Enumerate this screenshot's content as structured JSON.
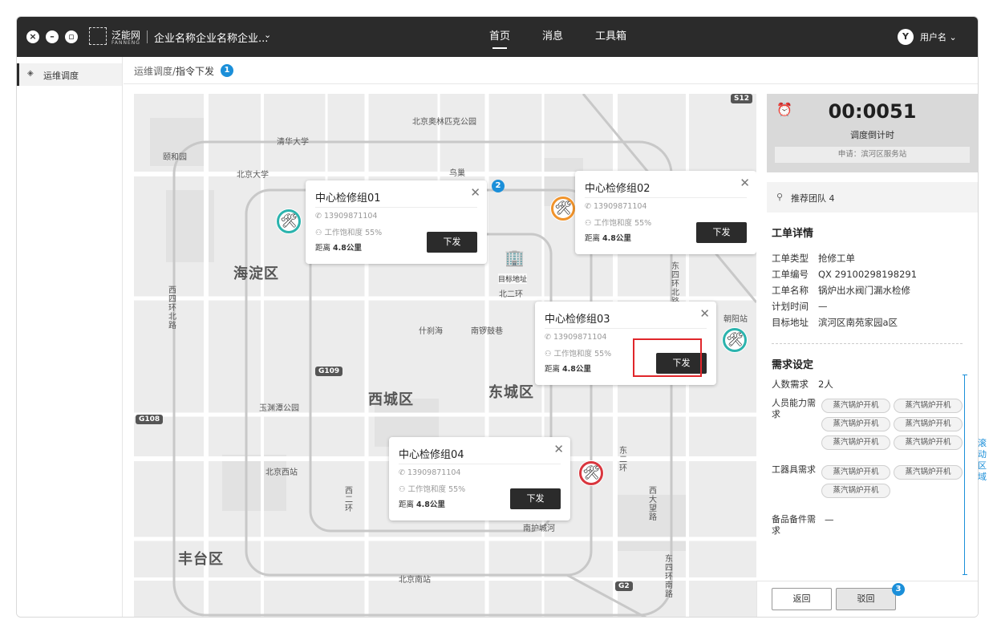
{
  "window": {
    "company": "企业名称企业名称企业...",
    "brand": "泛能网",
    "brand_en": "FANNENG"
  },
  "nav": [
    "首页",
    "消息",
    "工具箱"
  ],
  "user": {
    "initial": "Y",
    "name": "用户名"
  },
  "sidebar": {
    "item": "运维调度"
  },
  "breadcrumb": {
    "parent": "运维调度/",
    "current": "指令下发"
  },
  "markers": [
    "1",
    "2",
    "3"
  ],
  "map": {
    "districts": [
      "海淀区",
      "西城区",
      "东城区",
      "丰台区"
    ],
    "pois": [
      "清华大学",
      "北京大学",
      "北京奥林匹克公园",
      "颐和园",
      "什刹海",
      "南锣鼓巷",
      "玉渊潭公园",
      "北京西站",
      "北京南站",
      "朝阳站",
      "南护城河",
      "北二环",
      "鸟巢",
      "西四环北路",
      "东四环北路",
      "东二环",
      "西二环",
      "西大望路",
      "东四环南路"
    ],
    "road_badges": [
      "G109",
      "G108",
      "G2",
      "S12"
    ],
    "target_label": "目标地址",
    "pins": [
      {
        "icon": "🛠",
        "status": "teal"
      },
      {
        "icon": "🛠",
        "status": "orange"
      },
      {
        "icon": "🛠",
        "status": "teal"
      },
      {
        "icon": "🛠",
        "status": "red"
      }
    ]
  },
  "cards": [
    {
      "title": "中心检修组01",
      "phone": "13909871104",
      "load": "工作饱和度 55%",
      "dist_label": "距离",
      "dist": "4.8公里",
      "btn": "下发"
    },
    {
      "title": "中心检修组02",
      "phone": "13909871104",
      "load": "工作饱和度 55%",
      "dist_label": "距离",
      "dist": "4.8公里",
      "btn": "下发"
    },
    {
      "title": "中心检修组03",
      "phone": "13909871104",
      "load": "工作饱和度 55%",
      "dist_label": "距离",
      "dist": "4.8公里",
      "btn": "下发"
    },
    {
      "title": "中心检修组04",
      "phone": "13909871104",
      "load": "工作饱和度 55%",
      "dist_label": "距离",
      "dist": "4.8公里",
      "btn": "下发"
    }
  ],
  "panel": {
    "timer": "00:0051",
    "timer_label": "调度倒计时",
    "request": "申请：滨河区服务站",
    "team": "推荐团队  4",
    "order_title": "工单详情",
    "order": [
      {
        "k": "工单类型",
        "v": "抢修工单"
      },
      {
        "k": "工单编号",
        "v": "QX 29100298198291"
      },
      {
        "k": "工单名称",
        "v": "锅炉出水阀门漏水检修"
      },
      {
        "k": "计划时间",
        "v": "—"
      },
      {
        "k": "目标地址",
        "v": "滨河区南苑家园a区"
      }
    ],
    "demand_title": "需求设定",
    "headcount_k": "人数需求",
    "headcount_v": "2人",
    "skill_k": "人员能力需求",
    "skills": [
      "蒸汽锅炉开机",
      "蒸汽锅炉开机",
      "蒸汽锅炉开机",
      "蒸汽锅炉开机",
      "蒸汽锅炉开机",
      "蒸汽锅炉开机"
    ],
    "tools_k": "工器具需求",
    "tools": [
      "蒸汽锅炉开机",
      "蒸汽锅炉开机",
      "蒸汽锅炉开机"
    ],
    "spare_k": "备品备件需求",
    "spare_v": "—"
  },
  "scroll_note": "滚动区域",
  "footer": {
    "back": "返回",
    "reject": "驳回"
  }
}
